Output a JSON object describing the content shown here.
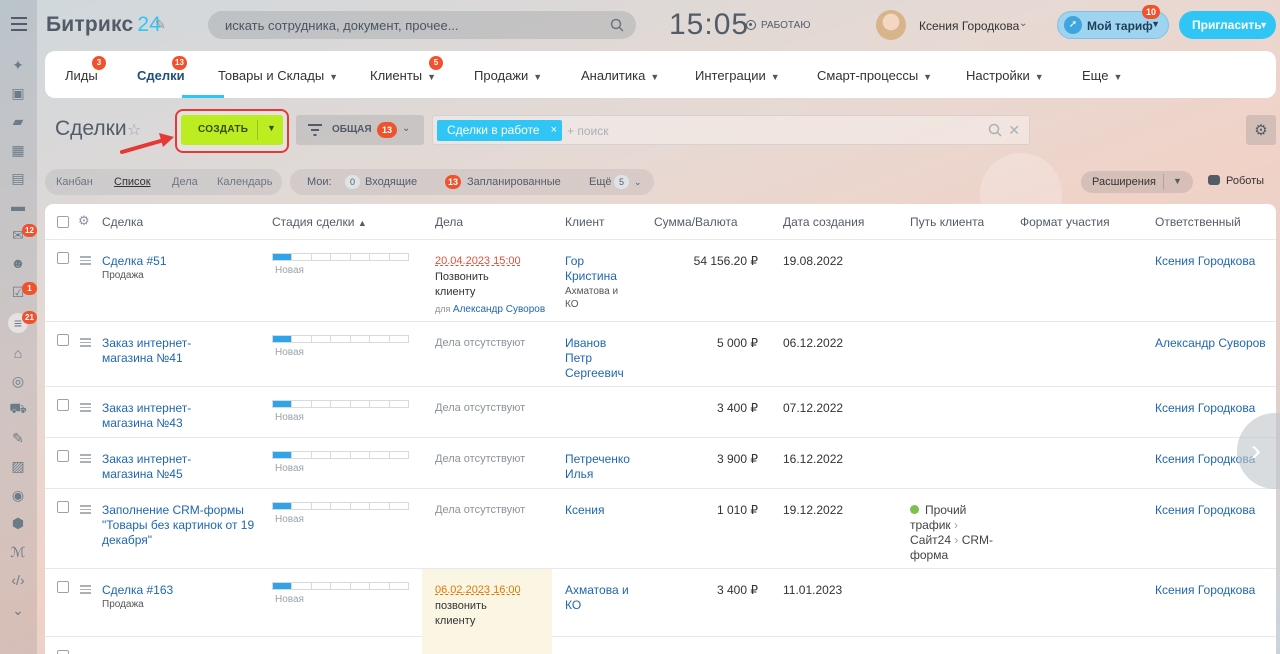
{
  "app": {
    "logo_text": "Битрикс",
    "logo_num": "24"
  },
  "search": {
    "placeholder": "искать сотрудника, документ, прочее..."
  },
  "clock": {
    "time": "15:05",
    "status": "РАБОТАЮ"
  },
  "user": {
    "name": "Ксения Городкова"
  },
  "tariff": {
    "label": "Мой тариф",
    "badge": "10"
  },
  "invite": {
    "label": "Пригласить"
  },
  "sidebar": {
    "badges": [
      "12",
      "1",
      "21"
    ]
  },
  "nav": {
    "items": [
      {
        "label": "Лиды",
        "badge": "3"
      },
      {
        "label": "Сделки",
        "badge": "13"
      },
      {
        "label": "Товары и Склады"
      },
      {
        "label": "Клиенты",
        "badge": "5"
      },
      {
        "label": "Продажи"
      },
      {
        "label": "Аналитика"
      },
      {
        "label": "Интеграции"
      },
      {
        "label": "Смарт-процессы"
      },
      {
        "label": "Настройки"
      },
      {
        "label": "Еще"
      }
    ]
  },
  "toolbar": {
    "title": "Сделки",
    "create_label": "СОЗДАТЬ",
    "filter_label": "ОБЩАЯ",
    "filter_badge": "13",
    "filter_tag": "Сделки в работе",
    "filter_placeholder": "+ поиск"
  },
  "views": {
    "tabs": [
      "Канбан",
      "Список",
      "Дела",
      "Календарь"
    ]
  },
  "counters": {
    "my_label": "Мои:",
    "incoming_count": "0",
    "incoming_label": "Входящие",
    "planned_count": "13",
    "planned_label": "Запланированные",
    "more_label": "Ещё",
    "more_count": "5"
  },
  "extensions": {
    "label": "Расширения",
    "robots": "Роботы"
  },
  "table": {
    "headers": [
      "Сделка",
      "Стадия сделки",
      "Дела",
      "Клиент",
      "Сумма/Валюта",
      "Дата создания",
      "Путь клиента",
      "Формат участия",
      "Ответственный"
    ],
    "rows": [
      {
        "deal": "Сделка #51",
        "deal_sub": "Продажа",
        "stage": "Новая",
        "act_deadline": "20.04.2023 15:00",
        "act_text": "Позвонить клиенту",
        "act_for": "для",
        "act_person": "Александр Суворов",
        "client": "Гор Кристина",
        "client_sub": "Ахматова и КО",
        "sum": "54 156.20 ₽",
        "date": "19.08.2022",
        "path": "",
        "owner": "Ксения Городкова"
      },
      {
        "deal": "Заказ интернет-магазина №41",
        "deal_sub": "",
        "stage": "Новая",
        "act_none": "Дела отсутствуют",
        "client": "Иванов Петр Сергеевич",
        "client_sub": "",
        "sum": "5 000 ₽",
        "date": "06.12.2022",
        "path": "",
        "owner": "Александр Суворов"
      },
      {
        "deal": "Заказ интернет-магазина №43",
        "deal_sub": "",
        "stage": "Новая",
        "act_none": "Дела отсутствуют",
        "client": "",
        "client_sub": "",
        "sum": "3 400 ₽",
        "date": "07.12.2022",
        "path": "",
        "owner": "Ксения Городкова"
      },
      {
        "deal": "Заказ интернет-магазина №45",
        "deal_sub": "",
        "stage": "Новая",
        "act_none": "Дела отсутствуют",
        "client": "Петреченко Илья",
        "client_sub": "",
        "sum": "3 900 ₽",
        "date": "16.12.2022",
        "path": "",
        "owner": "Ксения Городкова"
      },
      {
        "deal": "Заполнение CRM-формы \"Товары без картинок от 19 декабря\"",
        "deal_sub": "",
        "stage": "Новая",
        "act_none": "Дела отсутствуют",
        "client": "Ксения",
        "client_sub": "",
        "sum": "1 010 ₽",
        "date": "19.12.2022",
        "path_1": "Прочий трафик",
        "path_2": "Сайт24",
        "path_3": "CRM-форма",
        "owner": "Ксения Городкова"
      },
      {
        "deal": "Сделка #163",
        "deal_sub": "Продажа",
        "stage": "Новая",
        "act_deadline": "06.02.2023 16:00",
        "act_text": "позвонить клиенту",
        "client": "Ахматова и КО",
        "client_sub": "",
        "sum": "3 400 ₽",
        "date": "11.01.2023",
        "path": "",
        "owner": "Ксения Городкова"
      }
    ]
  }
}
